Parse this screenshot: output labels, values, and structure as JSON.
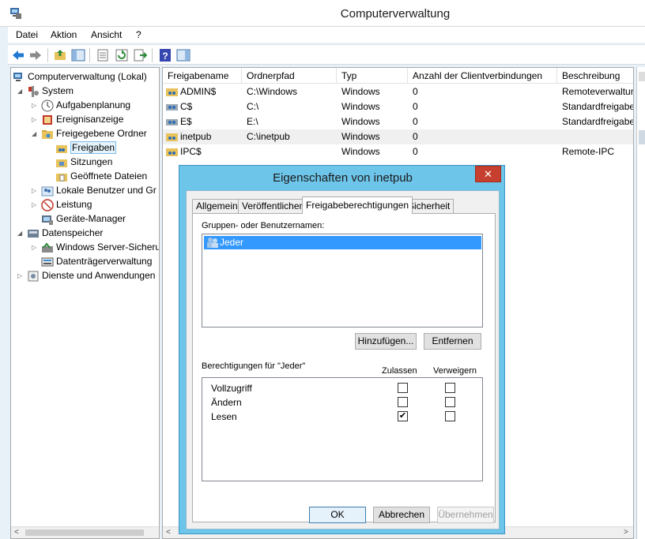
{
  "window": {
    "title": "Computerverwaltung",
    "top_cut_text": "Computerverwaltung"
  },
  "menu": [
    "Datei",
    "Aktion",
    "Ansicht",
    "?"
  ],
  "toolbar_icons": [
    "back-arrow-icon",
    "forward-arrow-icon",
    "up-folder-icon",
    "show-hide-tree-icon",
    "properties-icon",
    "refresh-icon",
    "export-list-icon",
    "help-icon",
    "action-pane-icon"
  ],
  "tree": {
    "items": [
      {
        "label": "Computerverwaltung (Lokal)",
        "icon": "computer-management-icon"
      },
      {
        "label": "System",
        "icon": "system-tools-icon"
      },
      {
        "label": "Aufgabenplanung",
        "icon": "clock-icon"
      },
      {
        "label": "Ereignisanzeige",
        "icon": "event-viewer-icon"
      },
      {
        "label": "Freigegebene Ordner",
        "icon": "shared-folder-icon"
      },
      {
        "label": "Freigaben",
        "icon": "share-icon"
      },
      {
        "label": "Sitzungen",
        "icon": "sessions-icon"
      },
      {
        "label": "Geöffnete Dateien",
        "icon": "open-files-icon"
      },
      {
        "label": "Lokale Benutzer und Gr",
        "icon": "users-icon"
      },
      {
        "label": "Leistung",
        "icon": "performance-icon"
      },
      {
        "label": "Geräte-Manager",
        "icon": "device-manager-icon"
      },
      {
        "label": "Datenspeicher",
        "icon": "storage-icon"
      },
      {
        "label": "Windows Server-Sicheru",
        "icon": "backup-icon"
      },
      {
        "label": "Datenträgerverwaltung",
        "icon": "disk-icon"
      },
      {
        "label": "Dienste und Anwendungen",
        "icon": "services-icon"
      }
    ]
  },
  "list": {
    "columns": [
      "Freigabename",
      "Ordnerpfad",
      "Typ",
      "Anzahl der Clientverbindungen",
      "Beschreibung"
    ],
    "rows": [
      {
        "name": "ADMIN$",
        "path": "C:\\Windows",
        "type": "Windows",
        "count": "0",
        "desc": "Remoteverwaltun"
      },
      {
        "name": "C$",
        "path": "C:\\",
        "type": "Windows",
        "count": "0",
        "desc": "Standardfreigabe"
      },
      {
        "name": "E$",
        "path": "E:\\",
        "type": "Windows",
        "count": "0",
        "desc": "Standardfreigabe"
      },
      {
        "name": "inetpub",
        "path": "C:\\inetpub",
        "type": "Windows",
        "count": "0",
        "desc": ""
      },
      {
        "name": "IPC$",
        "path": "",
        "type": "Windows",
        "count": "0",
        "desc": "Remote-IPC"
      }
    ]
  },
  "dialog": {
    "title": "Eigenschaften von inetpub",
    "close": "✕",
    "tabs": [
      "Allgemein",
      "Veröffentlichen",
      "Freigabeberechtigungen",
      "Sicherheit"
    ],
    "active_tab": "Freigabeberechtigungen",
    "groups_label": "Gruppen- oder Benutzernamen:",
    "groups": [
      "Jeder"
    ],
    "add_button": "Hinzufügen...",
    "remove_button": "Entfernen",
    "perm_label": "Berechtigungen für \"Jeder\"",
    "allow_header": "Zulassen",
    "deny_header": "Verweigern",
    "permissions": [
      {
        "name": "Vollzugriff",
        "allow": false,
        "deny": false
      },
      {
        "name": "Ändern",
        "allow": false,
        "deny": false
      },
      {
        "name": "Lesen",
        "allow": true,
        "deny": false
      }
    ],
    "ok": "OK",
    "cancel": "Abbrechen",
    "apply": "Übernehmen"
  }
}
